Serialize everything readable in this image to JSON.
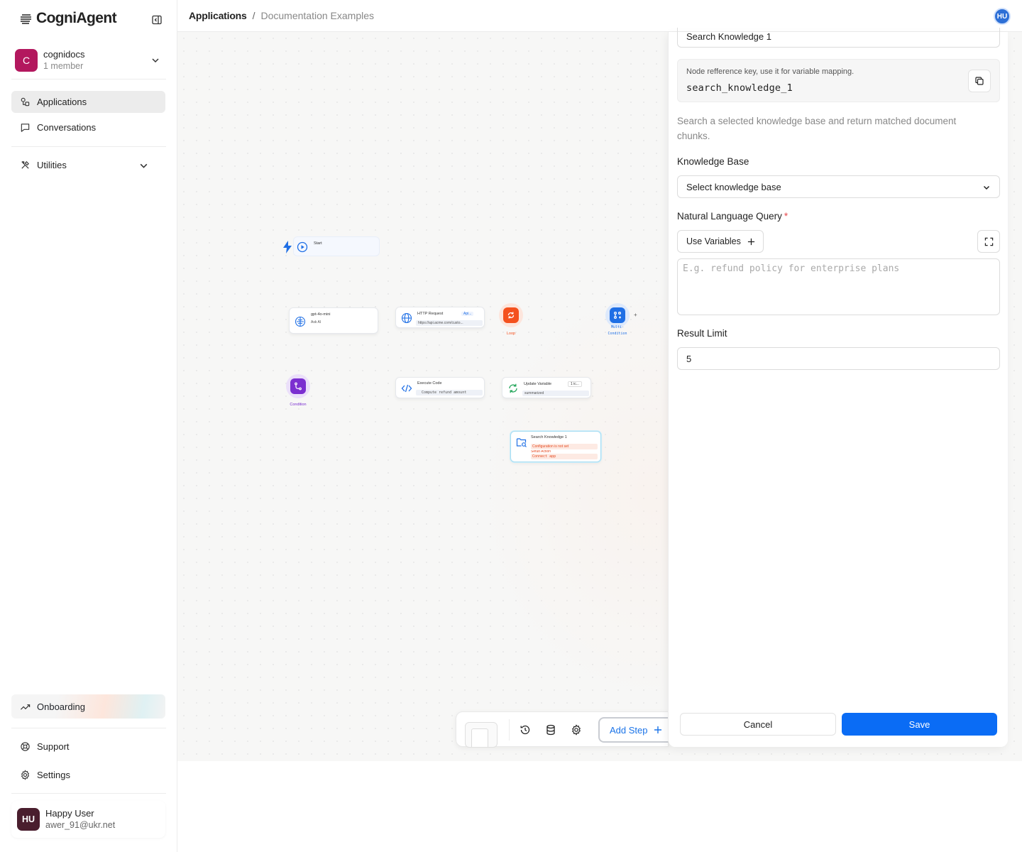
{
  "brand": {
    "name": "CogniAgent"
  },
  "workspace": {
    "name": "cognidocs",
    "members": "1 member",
    "initial": "C"
  },
  "sidebar": {
    "items": [
      {
        "label": "Applications",
        "icon": "shapes-icon",
        "active": true
      },
      {
        "label": "Conversations",
        "icon": "message-square-icon",
        "active": false
      },
      {
        "label": "Utilities",
        "icon": "tools-icon",
        "active": false
      }
    ],
    "onboarding": "Onboarding",
    "support": "Support",
    "settings": "Settings"
  },
  "user": {
    "initials": "HU",
    "name": "Happy User",
    "email": "awer_91@ukr.net"
  },
  "header": {
    "breadcrumb_root": "Applications",
    "breadcrumb_sep": "/",
    "breadcrumb_current": "Documentation Examples",
    "avatar_initials": "HU"
  },
  "canvas": {
    "nodes": {
      "start": {
        "title": "Start"
      },
      "ask_ai": {
        "title": "gpt-4o-mini",
        "subtitle": "Ask AI"
      },
      "http": {
        "title": "HTTP Request",
        "badge": "Api...",
        "subtitle": "https://api.acme.com/custo..."
      },
      "loop": {
        "label": "Loop"
      },
      "multi": {
        "label_1": "Multi-",
        "label_2": "Condition"
      },
      "condition": {
        "label": "Condition"
      },
      "exec_code": {
        "title": "Execute Code",
        "subtitle": "Compute  refund  amount"
      },
      "update_var": {
        "title": "Update Variable",
        "badge": "1 ic...",
        "subtitle": "summarized"
      },
      "search_kb": {
        "title": "Search Knowledge 1",
        "warn_1": "Configuration is not set",
        "warn_2": "Setup Action",
        "warn_3": "Connect  app"
      }
    }
  },
  "toolbar": {
    "add_step": "Add Step"
  },
  "panel": {
    "step_name": "Search Knowledge 1",
    "ref_label": "Node refference key, use it for variable mapping.",
    "ref_key": "search_knowledge_1",
    "description": "Search a selected knowledge base and return matched document chunks.",
    "kb_label": "Knowledge Base",
    "kb_value": "Select knowledge base",
    "query_label": "Natural Language Query",
    "required_mark": "*",
    "use_variables": "Use Variables",
    "query_placeholder": "E.g. refund policy for enterprise plans",
    "limit_label": "Result Limit",
    "limit_value": "5",
    "cancel": "Cancel",
    "save": "Save"
  },
  "colors": {
    "accent": "#0a6cf5",
    "workspace_avatar": "#b3185e",
    "loop": "#f4511e",
    "condition": "#7b2fd0",
    "multi_condition": "#1f6fe5"
  }
}
